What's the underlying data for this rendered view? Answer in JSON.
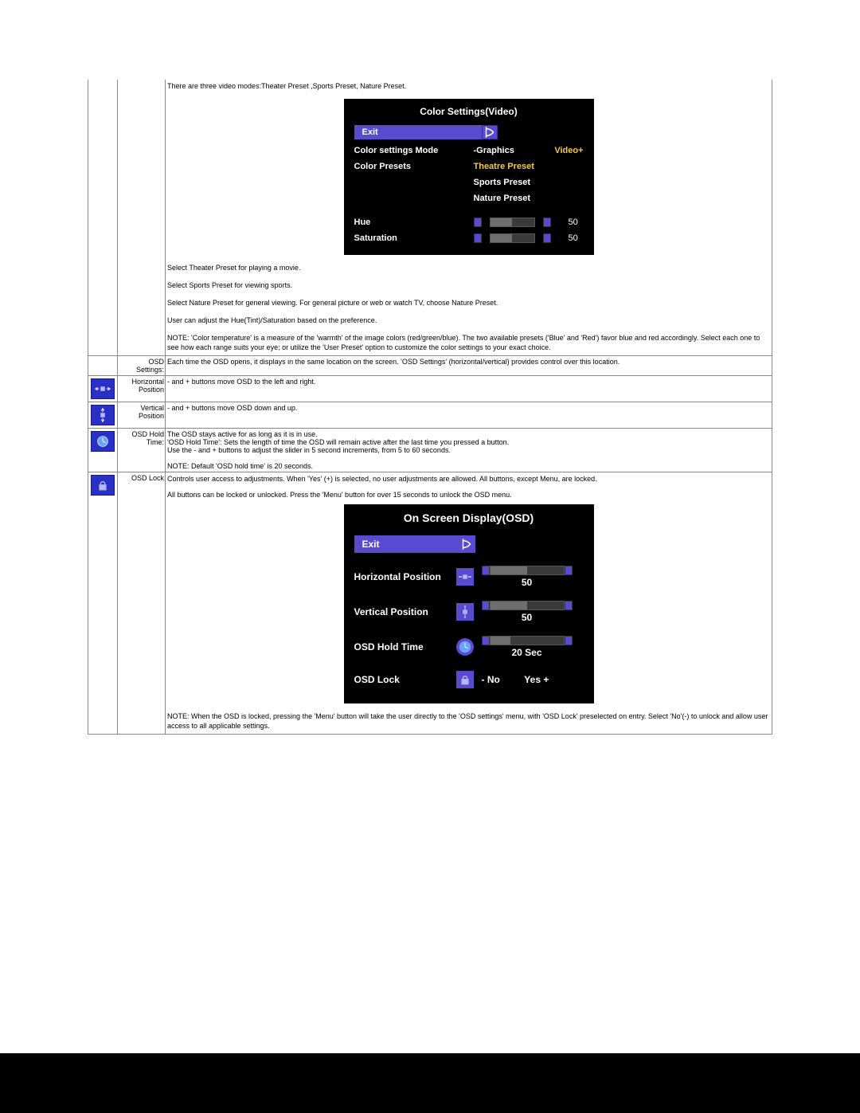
{
  "row_color_settings": {
    "intro": "There are three video modes:Theater Preset ,Sports Preset, Nature Preset.",
    "panel": {
      "title": "Color Settings(Video)",
      "exit": "Exit",
      "mode_label": "Color settings Mode",
      "mode_prefix": "-Graphics",
      "mode_active": "Video+",
      "presets_label": "Color Presets",
      "preset_theatre": "Theatre Preset",
      "preset_sports": "Sports Preset",
      "preset_nature": "Nature Preset",
      "hue_label": "Hue",
      "hue_value": "50",
      "sat_label": "Saturation",
      "sat_value": "50"
    },
    "p_theater": "Select Theater Preset for playing a movie.",
    "p_sports": "Select Sports Preset for viewing sports.",
    "p_nature": "Select Nature Preset for general viewing. For general picture or web or watch TV, choose Nature Preset.",
    "p_hue": "User can adjust the Hue(Tint)/Saturation based on the preference.",
    "p_note": "NOTE: 'Color temperature' is a measure of the 'warmth' of the image colors (red/green/blue). The two available presets ('Blue' and 'Red') favor blue and red accordingly. Select each one to see how each range suits your eye; or utilize the 'User Preset' option to customize the color settings to your exact choice."
  },
  "row_osd_settings": {
    "label": "OSD Settings:",
    "text": "Each time the OSD opens, it displays in the same location on the screen. 'OSD Settings' (horizontal/vertical) provides control over this location."
  },
  "row_hpos": {
    "label": "Horizontal Position",
    "text": "- and + buttons move OSD to the left and right."
  },
  "row_vpos": {
    "label": "Vertical Position",
    "text": "- and + buttons move OSD down and up."
  },
  "row_hold": {
    "label": "OSD Hold Time:",
    "line1": "The OSD stays active for as long as it is in use.",
    "line2": "'OSD Hold Time': Sets the length of time the OSD will remain active after the last time you pressed a button.",
    "line3": "Use the - and + buttons to adjust the slider in 5 second increments, from 5 to 60 seconds.",
    "note": "NOTE: Default 'OSD hold time' is 20 seconds."
  },
  "row_lock": {
    "label": "OSD Lock",
    "line1": "Controls user access to adjustments. When 'Yes' (+) is selected, no user adjustments are allowed. All buttons, except Menu, are locked.",
    "line2": "All buttons can be locked or unlocked. Press the 'Menu' button for over 15 seconds to unlock the OSD menu.",
    "panel": {
      "title": "On Screen Display(OSD)",
      "exit": "Exit",
      "hpos_label": "Horizontal Position",
      "hpos_value": "50",
      "vpos_label": "Vertical  Position",
      "vpos_value": "50",
      "hold_label": "OSD Hold Time",
      "hold_value": "20 Sec",
      "lock_label": "OSD Lock",
      "lock_no": "- No",
      "lock_yes": "Yes +"
    },
    "note": "NOTE: When the OSD is locked, pressing the 'Menu' button will take the user directly to the 'OSD settings' menu, with 'OSD Lock' preselected on entry. Select 'No'(-) to unlock and allow user access to all applicable settings."
  }
}
